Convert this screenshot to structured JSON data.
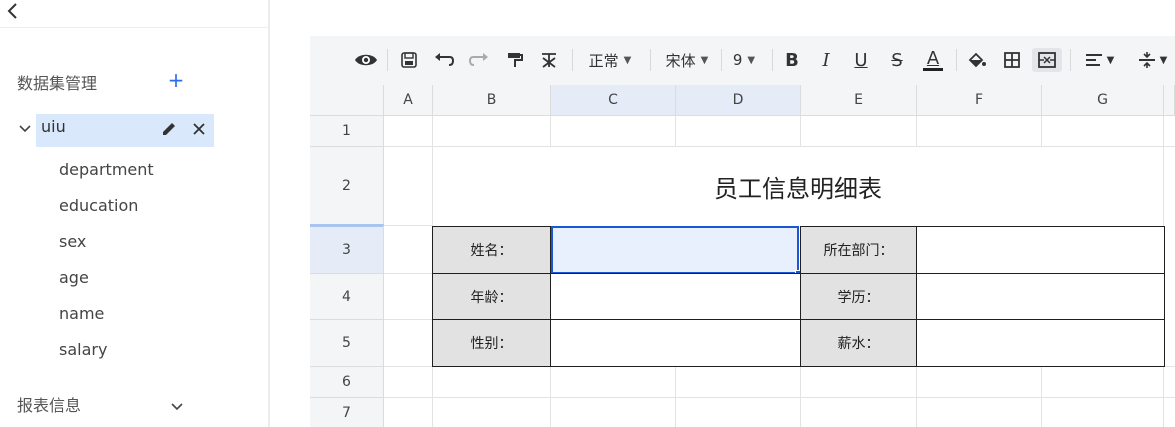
{
  "sidebar": {
    "section_title": "数据集管理",
    "add_label": "+",
    "dataset": {
      "name": "uiu"
    },
    "fields": [
      "department",
      "education",
      "sex",
      "age",
      "name",
      "salary"
    ],
    "report_section_title": "报表信息"
  },
  "toolbar": {
    "style_select": "正常",
    "font_select": "宋体",
    "size_select": "9",
    "bold": "B",
    "italic": "I",
    "underline": "U",
    "strike": "S",
    "font_color": "A"
  },
  "sheet": {
    "columns": [
      "A",
      "B",
      "C",
      "D",
      "E",
      "F",
      "G"
    ],
    "rows": [
      "1",
      "2",
      "3",
      "4",
      "5",
      "6",
      "7"
    ],
    "title": "员工信息明细表",
    "labels": {
      "name": "姓名：",
      "department": "所在部门：",
      "age": "年龄：",
      "education": "学历：",
      "sex": "性别：",
      "salary": "薪水："
    },
    "selected_cell": "C3"
  },
  "colors": {
    "accent": "#1a57d6",
    "selection_fill": "#e8f0fe",
    "dataset_highlight": "#dae8fc",
    "label_fill": "#e2e2e2"
  }
}
